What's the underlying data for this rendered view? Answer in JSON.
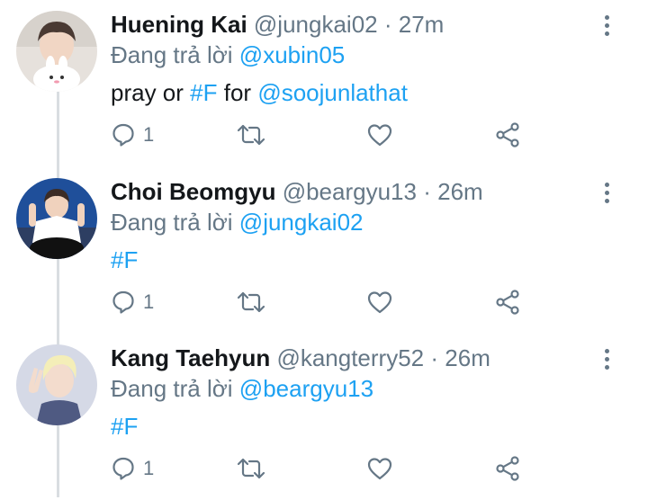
{
  "tweets": [
    {
      "name": "Huening Kai",
      "handle": "@jungkai02",
      "time": "27m",
      "reply_prefix": "Đang trả lời",
      "reply_to": "@xubin05",
      "body": {
        "text1": "pray or",
        "hashtag": "#F",
        "text2": "for",
        "mention": "@soojunlathat"
      },
      "reply_count": "1"
    },
    {
      "name": "Choi Beomgyu",
      "handle": "@beargyu13",
      "time": "26m",
      "reply_prefix": "Đang trả lời",
      "reply_to": "@jungkai02",
      "body": {
        "hashtag": "#F"
      },
      "reply_count": "1"
    },
    {
      "name": "Kang Taehyun",
      "handle": "@kangterry52",
      "time": "26m",
      "reply_prefix": "Đang trả lời",
      "reply_to": "@beargyu13",
      "body": {
        "hashtag": "#F"
      },
      "reply_count": "1"
    }
  ],
  "separator": "·",
  "colors": {
    "link": "#1da1f2",
    "meta": "#657786",
    "thread_line": "#d9dde1"
  },
  "icons": [
    "reply-icon",
    "retweet-icon",
    "like-icon",
    "share-icon",
    "more-options-icon"
  ]
}
